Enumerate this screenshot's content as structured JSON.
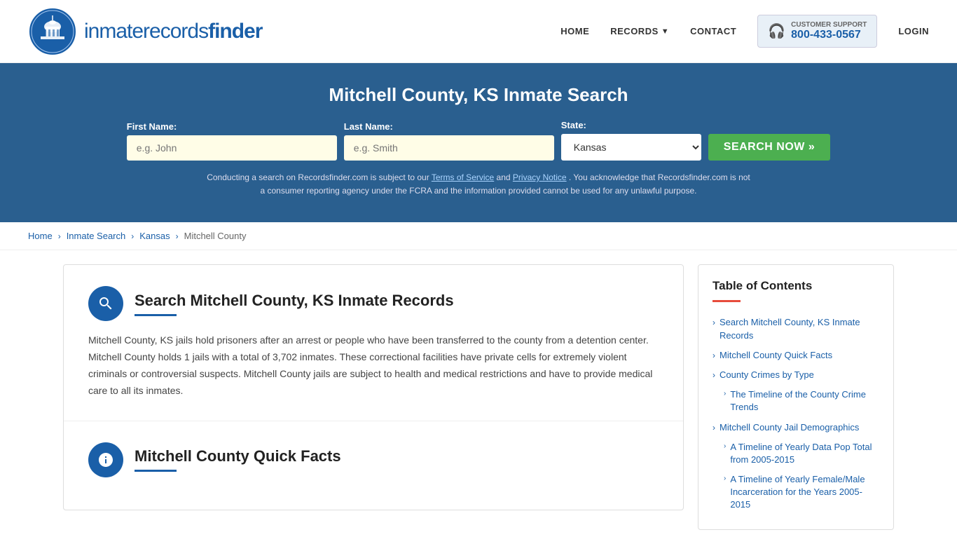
{
  "header": {
    "logo_text_normal": "inmaterecords",
    "logo_text_bold": "finder",
    "nav": {
      "home": "HOME",
      "records": "RECORDS",
      "contact": "CONTACT",
      "login": "LOGIN"
    },
    "support": {
      "label": "CUSTOMER SUPPORT",
      "phone": "800-433-0567"
    }
  },
  "hero": {
    "title": "Mitchell County, KS Inmate Search",
    "form": {
      "first_name_label": "First Name:",
      "first_name_placeholder": "e.g. John",
      "last_name_label": "Last Name:",
      "last_name_placeholder": "e.g. Smith",
      "state_label": "State:",
      "state_value": "Kansas",
      "search_button": "SEARCH NOW »"
    },
    "disclaimer": "Conducting a search on Recordsfinder.com is subject to our Terms of Service and Privacy Notice. You acknowledge that Recordsfinder.com is not a consumer reporting agency under the FCRA and the information provided cannot be used for any unlawful purpose."
  },
  "breadcrumb": {
    "home": "Home",
    "inmate_search": "Inmate Search",
    "kansas": "Kansas",
    "mitchell_county": "Mitchell County"
  },
  "content": {
    "section1": {
      "title": "Search Mitchell County, KS Inmate Records",
      "body": "Mitchell County, KS jails hold prisoners after an arrest or people who have been transferred to the county from a detention center. Mitchell County holds 1 jails with a total of 3,702 inmates. These correctional facilities have private cells for extremely violent criminals or controversial suspects. Mitchell County jails are subject to health and medical restrictions and have to provide medical care to all its inmates."
    },
    "section2": {
      "title": "Mitchell County Quick Facts"
    }
  },
  "toc": {
    "title": "Table of Contents",
    "items": [
      {
        "label": "Search Mitchell County, KS Inmate Records",
        "sub": false
      },
      {
        "label": "Mitchell County Quick Facts",
        "sub": false
      },
      {
        "label": "County Crimes by Type",
        "sub": false
      },
      {
        "label": "The Timeline of the County Crime Trends",
        "sub": true
      },
      {
        "label": "Mitchell County Jail Demographics",
        "sub": false
      },
      {
        "label": "A Timeline of Yearly Data Pop Total from 2005-2015",
        "sub": true
      },
      {
        "label": "A Timeline of Yearly Female/Male Incarceration for the Years 2005-2015",
        "sub": true
      }
    ]
  }
}
